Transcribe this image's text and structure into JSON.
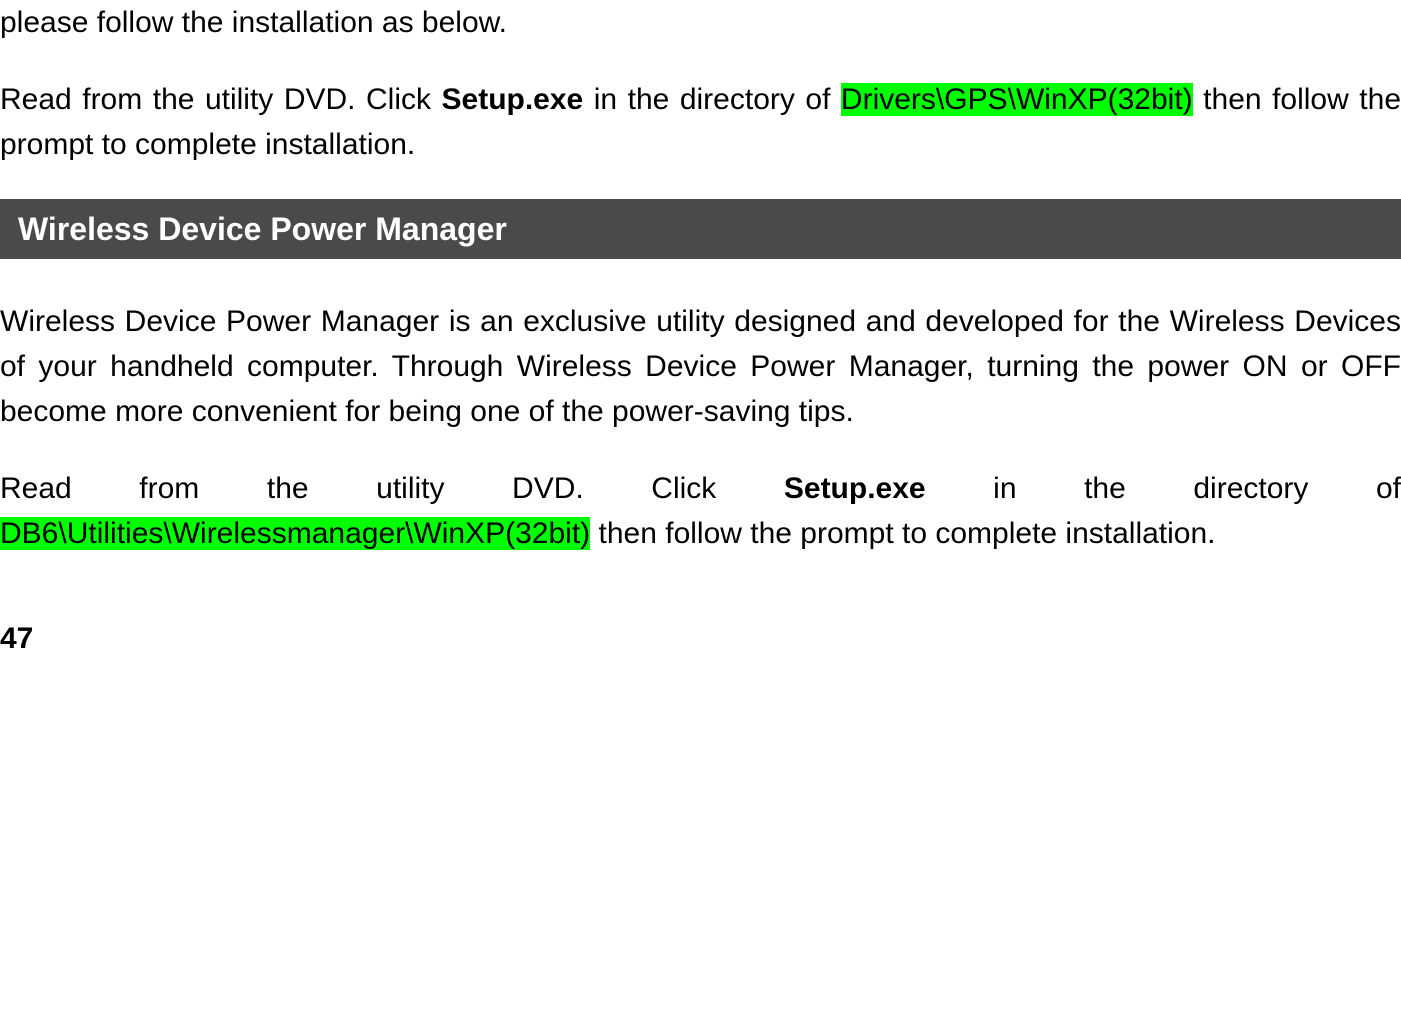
{
  "para1": {
    "text": "please follow the installation as below."
  },
  "para2": {
    "prefix": "Read from the utility DVD. Click ",
    "bold": "Setup.exe",
    "mid": " in the directory of ",
    "highlight": "Drivers\\GPS\\WinXP(32bit)",
    "suffix": " then follow the prompt to complete installation."
  },
  "section_header": " Wireless Device Power Manager",
  "para3": {
    "text": "Wireless Device Power Manager is an exclusive utility designed and developed for the Wireless Devices of your handheld computer. Through Wireless Device Power Manager, turning the power ON or OFF become more convenient for being one of the power-saving tips."
  },
  "para4": {
    "prefix": "Read from the utility DVD. Click ",
    "bold": "Setup.exe",
    "mid": " in the directory of ",
    "highlight": "DB6\\Utilities\\Wirelessmanager\\WinXP(32bit)",
    "suffix": " then follow the prompt to complete installation."
  },
  "page_number": "47"
}
